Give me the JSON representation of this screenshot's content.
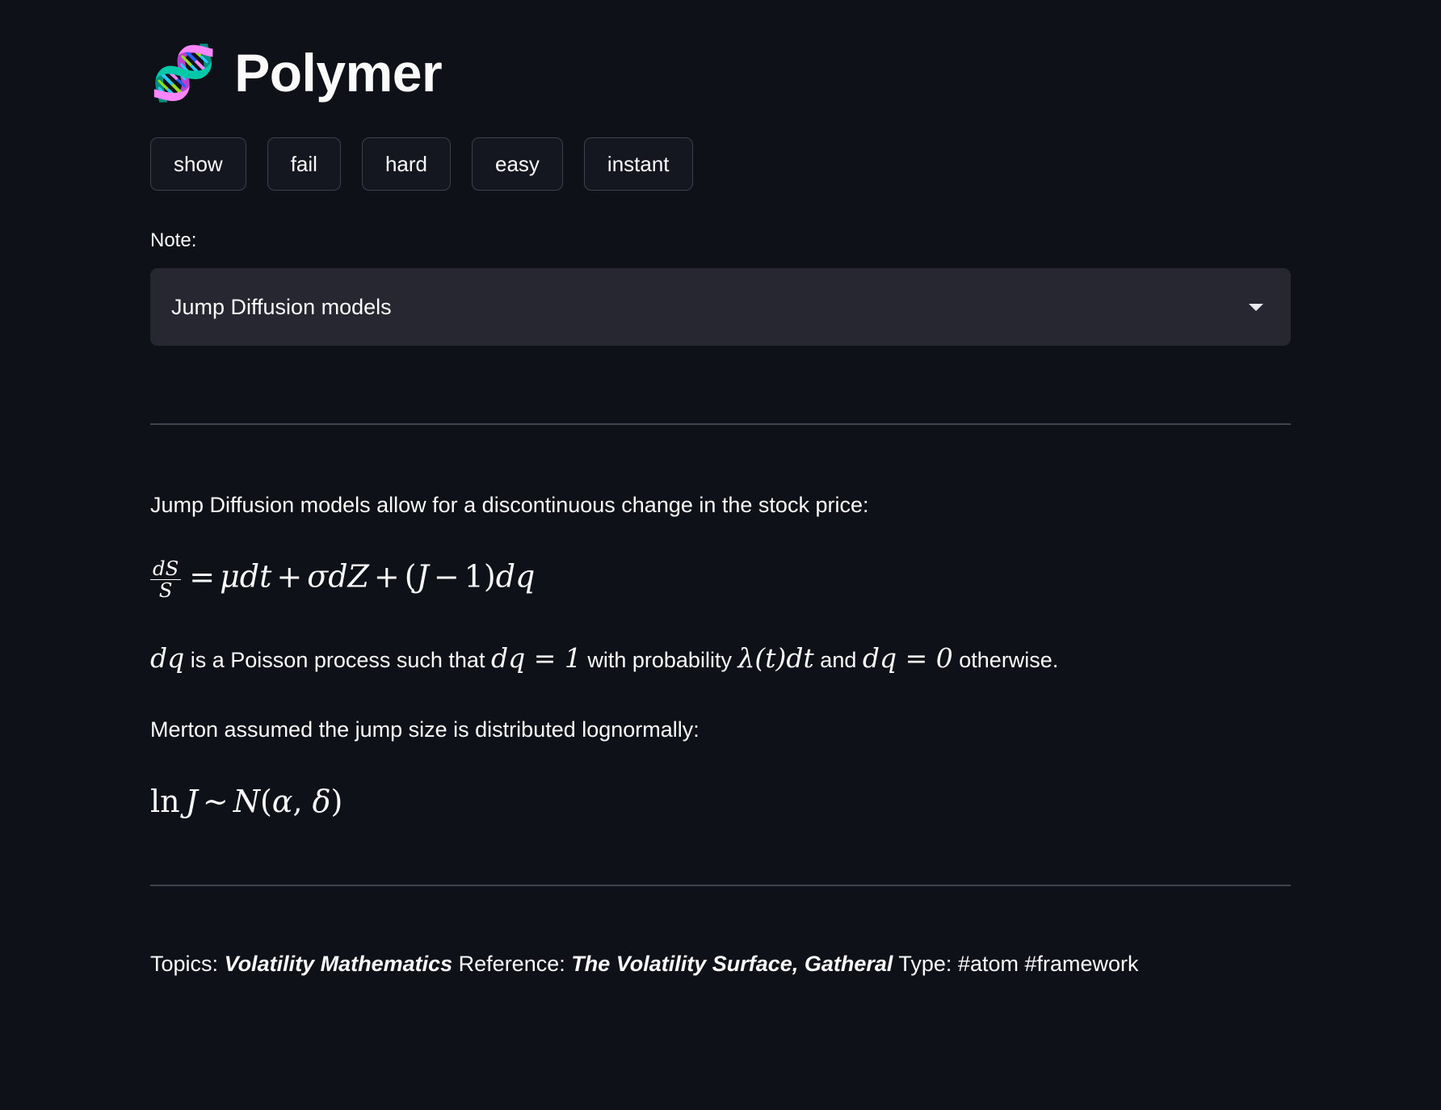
{
  "app": {
    "title": "Polymer",
    "logo_icon": "dna-emoji",
    "logo_glyph": "🧬"
  },
  "colors": {
    "background": "#0e1117",
    "text": "#fafafa",
    "button_bg": "#14171f",
    "button_border": "#3b414d",
    "select_bg": "#262730",
    "divider": "#41444c"
  },
  "toolbar": {
    "buttons": [
      {
        "label": "show",
        "name": "show-button"
      },
      {
        "label": "fail",
        "name": "fail-button"
      },
      {
        "label": "hard",
        "name": "hard-button"
      },
      {
        "label": "easy",
        "name": "easy-button"
      },
      {
        "label": "instant",
        "name": "instant-button"
      }
    ]
  },
  "note_selector": {
    "label": "Note:",
    "selected": "Jump Diffusion models",
    "chevron_icon": "chevron-down-icon"
  },
  "card": {
    "paragraph_1": "Jump Diffusion models allow for a discontinuous change in the stock price:",
    "formula_1": {
      "latex": "\\frac{dS}{S} = \\mu dt + \\sigma dZ + (J - 1)dq",
      "plain": "dS/S = μdt + σdZ + (J − 1)dq",
      "numerator": "dS",
      "denominator": "S",
      "equals": "=",
      "term_mu": "μ",
      "term_dt": "dt",
      "plus_1": "+",
      "term_sigma": "σ",
      "term_dZ": "dZ",
      "plus_2": "+",
      "open_paren": "(",
      "term_J": "J",
      "minus": "−",
      "one": "1",
      "close_paren": ")",
      "term_dq": "dq"
    },
    "paragraph_2": {
      "math_1": "dq",
      "text_1": "is a Poisson process such that",
      "math_2": "dq = 1",
      "text_2": "with probability",
      "math_3": "λ(t)dt",
      "text_3": "and",
      "math_4": "dq = 0",
      "text_4": "otherwise."
    },
    "paragraph_3": "Merton assumed the jump size is distributed lognormally:",
    "formula_2": {
      "latex": "\\ln J \\sim N(\\alpha, \\delta)",
      "plain": "ln J ~ N(α, δ)",
      "op_ln": "ln",
      "term_J": "J",
      "sim": "∼",
      "term_N": "N",
      "open_paren": "(",
      "term_alpha": "α",
      "comma": ",",
      "term_delta": "δ",
      "close_paren": ")"
    }
  },
  "footer": {
    "topics_label": "Topics:",
    "topics_value": "Volatility Mathematics",
    "reference_label": "Reference:",
    "reference_value": "The Volatility Surface, Gatheral",
    "type_label": "Type:",
    "type_value": "#atom #framework"
  }
}
